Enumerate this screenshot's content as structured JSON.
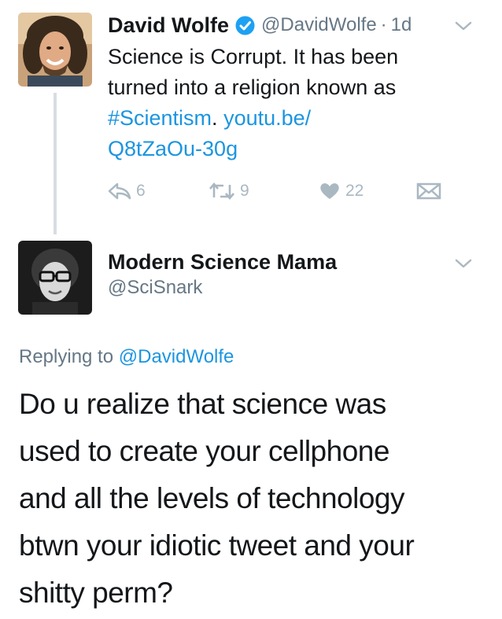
{
  "tweet1": {
    "display_name": "David Wolfe",
    "handle": "@DavidWolfe",
    "separator": "·",
    "time": "1d",
    "text_lines": [
      "Science is Corrupt. It has been",
      "turned into a religion known as"
    ],
    "hashtag": "#Scientism",
    "period": ".",
    "link_part1": "youtu.be/",
    "link_part2": "Q8tZaOu-30g",
    "reply_count": "6",
    "retweet_count": "9",
    "like_count": "22",
    "colors": {
      "link": "#1b95e0",
      "verified": "#1da1f2",
      "action_icon": "#aab8c2"
    },
    "icons": [
      "verified-badge-icon",
      "chevron-down-icon",
      "reply-icon",
      "retweet-icon",
      "heart-icon",
      "direct-message-icon"
    ]
  },
  "tweet2": {
    "display_name": "Modern Science Mama",
    "handle": "@SciSnark",
    "replying_prefix": "Replying to",
    "replying_to": "@DavidWolfe",
    "text_lines": [
      "Do u realize that science was",
      "used to create your cellphone",
      "and all the levels of technology",
      "btwn your idiotic tweet and your",
      "shitty perm?"
    ]
  }
}
